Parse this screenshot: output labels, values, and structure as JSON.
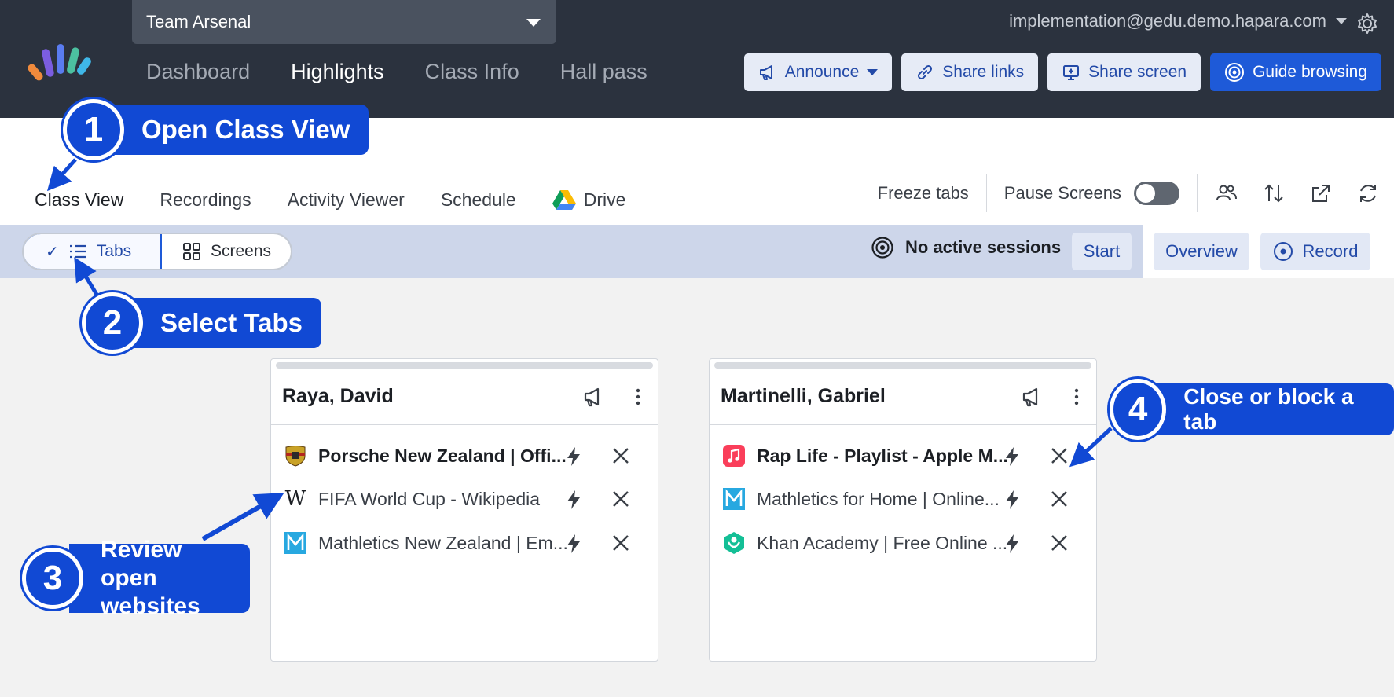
{
  "colors": {
    "topbar": "#2b323e",
    "accent": "#1e5ad8",
    "callout": "#1149d4",
    "band": "#cdd6ea"
  },
  "header": {
    "class_name": "Team Arsenal",
    "account": "implementation@gedu.demo.hapara.com",
    "nav": [
      "Dashboard",
      "Highlights",
      "Class Info",
      "Hall pass"
    ],
    "nav_active": "Highlights",
    "buttons": {
      "announce": "Announce",
      "share_links": "Share links",
      "share_screen": "Share screen",
      "guide_browsing": "Guide browsing"
    }
  },
  "subnav": {
    "tabs": [
      "Class View",
      "Recordings",
      "Activity Viewer",
      "Schedule",
      "Drive"
    ],
    "active": "Class View",
    "freeze_tabs": "Freeze tabs",
    "pause_screens": "Pause Screens",
    "pause_screens_on": false
  },
  "view_toggle": {
    "tabs": "Tabs",
    "screens": "Screens",
    "selected": "Tabs"
  },
  "sessions": {
    "status": "No active sessions",
    "start": "Start",
    "overview": "Overview",
    "record": "Record"
  },
  "students": [
    {
      "name": "Raya, David",
      "tabs": [
        {
          "title": "Porsche New Zealand | Offi...",
          "icon": "porsche-icon",
          "active": true
        },
        {
          "title": "FIFA World Cup - Wikipedia",
          "icon": "wikipedia-icon",
          "active": false
        },
        {
          "title": "Mathletics New Zealand | Em...",
          "icon": "mathletics-icon",
          "active": false
        }
      ]
    },
    {
      "name": "Martinelli, Gabriel",
      "tabs": [
        {
          "title": "Rap Life - Playlist - Apple M...",
          "icon": "apple-music-icon",
          "active": true
        },
        {
          "title": "Mathletics for Home | Online...",
          "icon": "mathletics-icon",
          "active": false
        },
        {
          "title": "Khan Academy | Free Online ...",
          "icon": "khan-academy-icon",
          "active": false
        }
      ]
    }
  ],
  "callouts": [
    {
      "number": "1",
      "text": "Open Class View"
    },
    {
      "number": "2",
      "text": "Select Tabs"
    },
    {
      "number": "3",
      "text": "Review open websites"
    },
    {
      "number": "4",
      "text": "Close or block a tab"
    }
  ]
}
